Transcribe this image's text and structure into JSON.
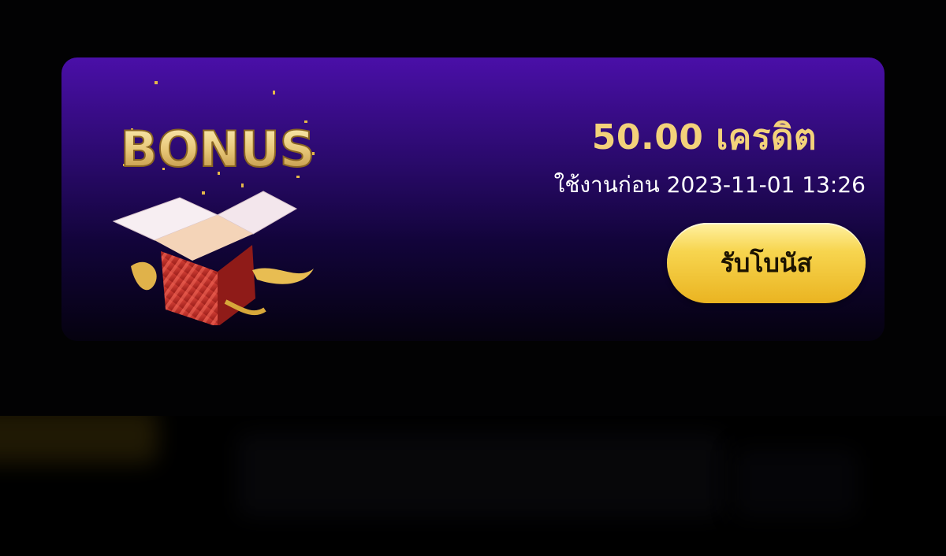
{
  "bonus_card": {
    "image_label": "BONUS",
    "amount": "50.00 เครดิต",
    "expiry": "ใช้งานก่อน 2023-11-01 13:26",
    "claim_label": "รับโบนัส"
  },
  "colors": {
    "card_top": "#4a0fa8",
    "card_bottom": "#05020f",
    "amount_gold": "#f3d27a",
    "button_gold": "#f7d54f",
    "box_red": "#c9322c"
  },
  "icons": [
    "bonus-gift-box-icon"
  ]
}
